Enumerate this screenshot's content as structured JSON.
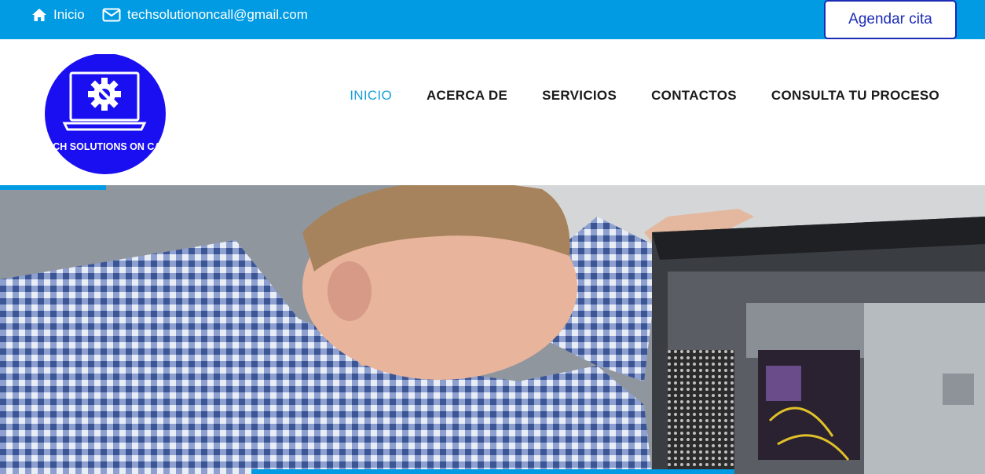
{
  "topbar": {
    "home_label": "Inicio",
    "email": "techsolutiononcall@gmail.com",
    "cta_label": "Agendar cita",
    "home_icon": "home-icon",
    "email_icon": "envelope-icon"
  },
  "logo": {
    "text": "TECH SOLUTIONS ON CALL",
    "color": "#1a0ff0"
  },
  "nav": {
    "items": [
      "INICIO",
      "ACERCA DE",
      "SERVICIOS",
      "CONTACTOS",
      "CONSULTA TU PROCESO"
    ],
    "active": "INICIO"
  },
  "colors": {
    "primary": "#009be3",
    "nav_active": "#1a9fd6",
    "cta_border": "#1b2bb5"
  }
}
